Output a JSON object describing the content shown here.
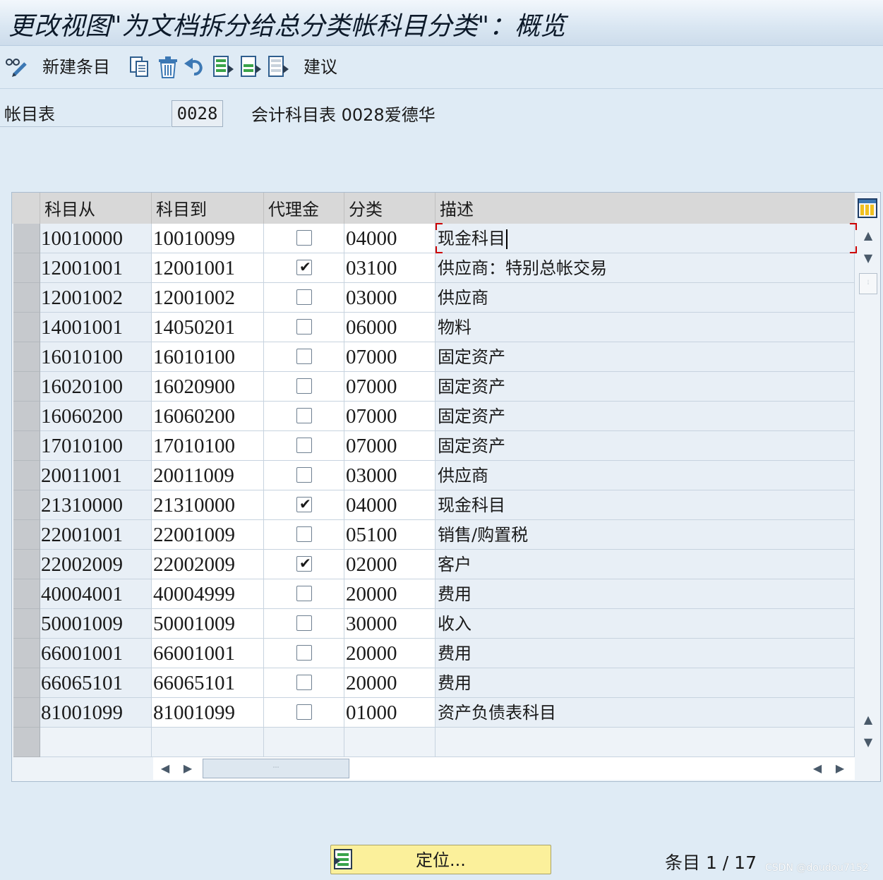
{
  "window": {
    "title": "更改视图\"为文档拆分给总分类帐科目分类\"：概览"
  },
  "toolbar": {
    "items": [
      {
        "label": "",
        "icon": "glasses-pencil-icon"
      },
      {
        "label": "新建条目",
        "icon": ""
      },
      {
        "label": "",
        "icon": "copy-icon"
      },
      {
        "label": "",
        "icon": "delete-icon"
      },
      {
        "label": "",
        "icon": "undo-icon"
      },
      {
        "label": "",
        "icon": "select-all-icon"
      },
      {
        "label": "",
        "icon": "select-block-icon"
      },
      {
        "label": "",
        "icon": "deselect-all-icon"
      },
      {
        "label": "建议",
        "icon": ""
      }
    ]
  },
  "header": {
    "label": "帐目表",
    "value": "0028",
    "description": "会计科目表 0028爱德华"
  },
  "table": {
    "columns": [
      "科目从",
      "科目到",
      "代理金",
      "分类",
      "描述"
    ],
    "rows": [
      {
        "from": "10010000",
        "to": "10010099",
        "proxy": false,
        "category": "04000",
        "desc": "现金科目"
      },
      {
        "from": "12001001",
        "to": "12001001",
        "proxy": true,
        "category": "03100",
        "desc": "供应商：特别总帐交易"
      },
      {
        "from": "12001002",
        "to": "12001002",
        "proxy": false,
        "category": "03000",
        "desc": "供应商"
      },
      {
        "from": "14001001",
        "to": "14050201",
        "proxy": false,
        "category": "06000",
        "desc": "物料"
      },
      {
        "from": "16010100",
        "to": "16010100",
        "proxy": false,
        "category": "07000",
        "desc": "固定资产"
      },
      {
        "from": "16020100",
        "to": "16020900",
        "proxy": false,
        "category": "07000",
        "desc": "固定资产"
      },
      {
        "from": "16060200",
        "to": "16060200",
        "proxy": false,
        "category": "07000",
        "desc": "固定资产"
      },
      {
        "from": "17010100",
        "to": "17010100",
        "proxy": false,
        "category": "07000",
        "desc": "固定资产"
      },
      {
        "from": "20011001",
        "to": "20011009",
        "proxy": false,
        "category": "03000",
        "desc": "供应商"
      },
      {
        "from": "21310000",
        "to": "21310000",
        "proxy": true,
        "category": "04000",
        "desc": "现金科目"
      },
      {
        "from": "22001001",
        "to": "22001009",
        "proxy": false,
        "category": "05100",
        "desc": "销售/购置税"
      },
      {
        "from": "22002009",
        "to": "22002009",
        "proxy": true,
        "category": "02000",
        "desc": "客户"
      },
      {
        "from": "40004001",
        "to": "40004999",
        "proxy": false,
        "category": "20000",
        "desc": "费用"
      },
      {
        "from": "50001009",
        "to": "50001009",
        "proxy": false,
        "category": "30000",
        "desc": "收入"
      },
      {
        "from": "66001001",
        "to": "66001001",
        "proxy": false,
        "category": "20000",
        "desc": "费用"
      },
      {
        "from": "66065101",
        "to": "66065101",
        "proxy": false,
        "category": "20000",
        "desc": "费用"
      },
      {
        "from": "81001099",
        "to": "81001099",
        "proxy": false,
        "category": "01000",
        "desc": "资产负债表科目"
      }
    ],
    "empty_row_count": 1,
    "focused_row": 0
  },
  "footer": {
    "position_button": "定位...",
    "entry_label": "条目 1 / 17",
    "watermark": "CSDN @doudou7152"
  },
  "colors": {
    "background": "#dfebf5",
    "position_button": "#fbf09b",
    "focus_marker": "#cc0000"
  }
}
